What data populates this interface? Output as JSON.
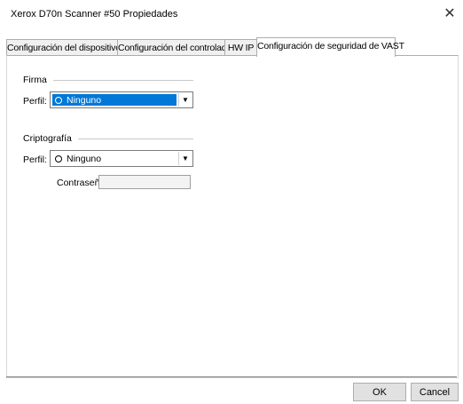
{
  "window": {
    "title": "Xerox D70n Scanner #50 Propiedades",
    "close_glyph": "✕"
  },
  "tabs": [
    {
      "label": "Configuración del dispositivo",
      "active": false
    },
    {
      "label": "Configuración del controlador",
      "active": false
    },
    {
      "label": "HW IP",
      "active": false
    },
    {
      "label": "Configuración de seguridad de VAST",
      "active": true
    }
  ],
  "firma": {
    "group_label": "Firma",
    "profile_label": "Perfil:",
    "profile_value": "Ninguno",
    "icon": "radio-icon"
  },
  "criptografia": {
    "group_label": "Criptografía",
    "profile_label": "Perfil:",
    "profile_value": "Ninguno",
    "password_label": "Contraseña:",
    "password_value": ""
  },
  "buttons": {
    "ok": "OK",
    "cancel": "Cancel"
  },
  "colors": {
    "selection": "#0078d7",
    "border": "#adadad"
  }
}
